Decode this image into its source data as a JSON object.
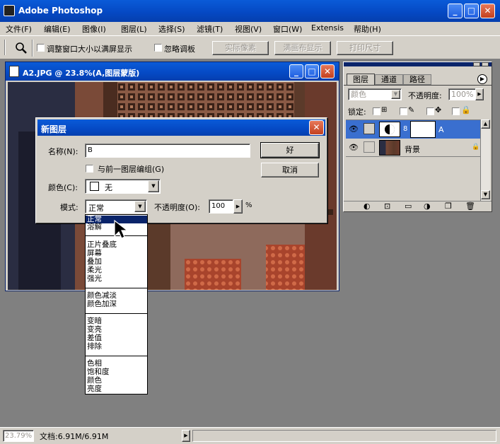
{
  "app": {
    "title": "Adobe Photoshop"
  },
  "menu": [
    "文件(F)",
    "编辑(E)",
    "图像(I)",
    "图层(L)",
    "选择(S)",
    "滤镜(T)",
    "视图(V)",
    "窗口(W)",
    "Extensis",
    "帮助(H)"
  ],
  "options": {
    "resize_label": "调整窗口大小以满屏显示",
    "ignore_palettes_label": "忽略调板",
    "actual_pixels": "实际像素",
    "fit_screen": "满画布显示",
    "print_size": "打印尺寸"
  },
  "document": {
    "title": "A2.JPG @ 23.8%(A,图层蒙版)"
  },
  "dialog": {
    "title": "新图层",
    "name_label": "名称(N):",
    "name_value": "B",
    "group_label": "与前一图层编组(G)",
    "color_label": "颜色(C):",
    "color_value": "无",
    "mode_label": "模式:",
    "mode_value": "正常",
    "opacity_label": "不透明度(O):",
    "opacity_value": "100",
    "percent": "%",
    "ok": "好",
    "cancel": "取消"
  },
  "mode_list": [
    [
      "正常",
      "溶解"
    ],
    [
      "正片叠底",
      "屏幕",
      "叠加",
      "柔光",
      "强光"
    ],
    [
      "颜色减淡",
      "颜色加深"
    ],
    [
      "变暗",
      "变亮",
      "差值",
      "排除"
    ],
    [
      "色相",
      "饱和度",
      "颜色",
      "亮度"
    ]
  ],
  "layers_panel": {
    "tabs": [
      "图层",
      "通道",
      "路径"
    ],
    "blend_mode": "颜色",
    "opacity_label": "不透明度:",
    "opacity_value": "100%",
    "lock_label": "锁定:",
    "layers": [
      {
        "name": "A",
        "selected": true
      },
      {
        "name": "背景",
        "selected": false
      }
    ]
  },
  "status": {
    "zoom": "23.79%",
    "doc_info": "文档:6.91M/6.91M"
  },
  "colors": {
    "title_blue": "#0549c4",
    "chrome": "#d4d0c8",
    "workspace": "#808080",
    "selection": "#0a246a"
  }
}
